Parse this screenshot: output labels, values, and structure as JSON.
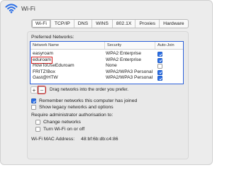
{
  "window": {
    "title": "Wi-Fi",
    "title_icon": "wifi-icon"
  },
  "tabs": [
    {
      "label": "Wi-Fi",
      "active": true
    },
    {
      "label": "TCP/IP",
      "active": false
    },
    {
      "label": "DNS",
      "active": false
    },
    {
      "label": "WINS",
      "active": false
    },
    {
      "label": "802.1X",
      "active": false
    },
    {
      "label": "Proxies",
      "active": false
    },
    {
      "label": "Hardware",
      "active": false
    }
  ],
  "preferred": {
    "heading": "Preferred Networks:",
    "columns": {
      "name": "Network Name",
      "security": "Security",
      "autojoin": "Auto-Join"
    },
    "rows": [
      {
        "name": "easyroam",
        "security": "WPA2 Enterprise",
        "autojoin": true
      },
      {
        "name": "eduroam",
        "security": "WPA2 Enterprise",
        "autojoin": true,
        "highlighted": true
      },
      {
        "name": "HowToUseEduroam",
        "security": "None",
        "autojoin": false
      },
      {
        "name": "FRITZ!Box",
        "security": "WPA2/WPA3 Personal",
        "autojoin": true
      },
      {
        "name": "Gast@HTW",
        "security": "WPA2/WPA3 Personal",
        "autojoin": true
      }
    ]
  },
  "controls": {
    "add_label": "+",
    "remove_label": "–",
    "drag_hint": "Drag networks into the order you prefer."
  },
  "options": {
    "remember": {
      "label": "Remember networks this computer has joined",
      "checked": true
    },
    "legacy": {
      "label": "Show legacy networks and options",
      "checked": false
    },
    "require_admin_heading": "Require administrator authorisation to:",
    "change_networks": {
      "label": "Change networks",
      "checked": false
    },
    "turn_wifi": {
      "label": "Turn Wi-Fi on or off",
      "checked": false
    }
  },
  "mac": {
    "label": "Wi-Fi MAC Address:",
    "value": "48:bf:6b:db:c4:86"
  },
  "colors": {
    "accent": "#2a6ee6",
    "highlight_red": "#d62020"
  }
}
